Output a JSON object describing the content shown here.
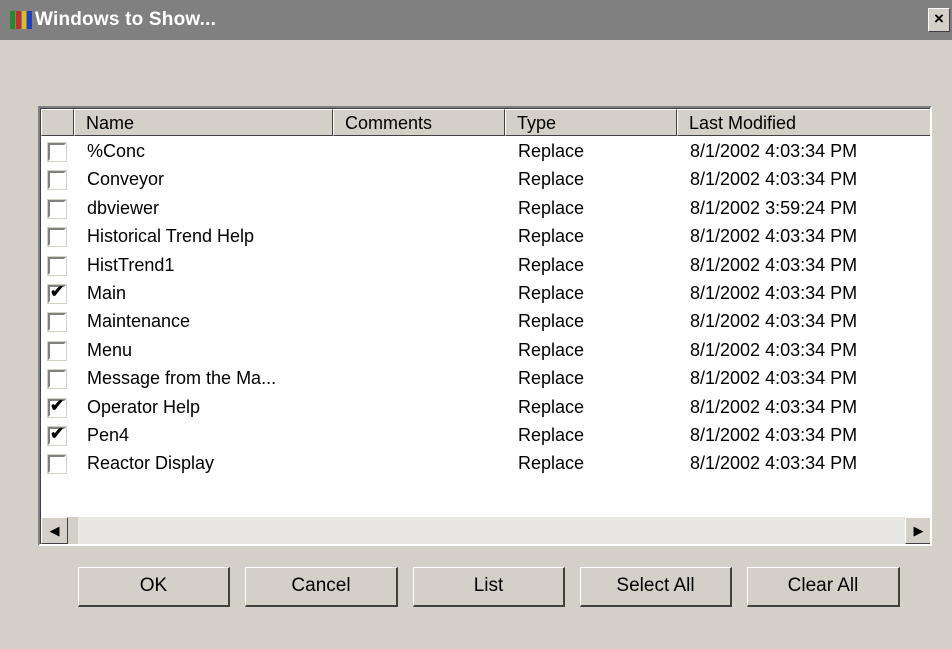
{
  "window": {
    "title": "Windows to Show...",
    "close_label": "×"
  },
  "columns": [
    "Name",
    "Comments",
    "Type",
    "Last Modified"
  ],
  "rows": [
    {
      "checked": false,
      "name": "%Conc",
      "comments": "",
      "type": "Replace",
      "modified": "8/1/2002 4:03:34 PM"
    },
    {
      "checked": false,
      "name": "Conveyor",
      "comments": "",
      "type": "Replace",
      "modified": "8/1/2002 4:03:34 PM"
    },
    {
      "checked": false,
      "name": "dbviewer",
      "comments": "",
      "type": "Replace",
      "modified": "8/1/2002 3:59:24 PM"
    },
    {
      "checked": false,
      "name": "Historical Trend Help",
      "comments": "",
      "type": "Replace",
      "modified": "8/1/2002 4:03:34 PM"
    },
    {
      "checked": false,
      "name": "HistTrend1",
      "comments": "",
      "type": "Replace",
      "modified": "8/1/2002 4:03:34 PM"
    },
    {
      "checked": true,
      "name": "Main",
      "comments": "",
      "type": "Replace",
      "modified": "8/1/2002 4:03:34 PM"
    },
    {
      "checked": false,
      "name": "Maintenance",
      "comments": "",
      "type": "Replace",
      "modified": "8/1/2002 4:03:34 PM"
    },
    {
      "checked": false,
      "name": "Menu",
      "comments": "",
      "type": "Replace",
      "modified": "8/1/2002 4:03:34 PM"
    },
    {
      "checked": false,
      "name": "Message from the Ma...",
      "comments": "",
      "type": "Replace",
      "modified": "8/1/2002 4:03:34 PM"
    },
    {
      "checked": true,
      "name": "Operator Help",
      "comments": "",
      "type": "Replace",
      "modified": "8/1/2002 4:03:34 PM"
    },
    {
      "checked": true,
      "name": "Pen4",
      "comments": "",
      "type": "Replace",
      "modified": "8/1/2002 4:03:34 PM"
    },
    {
      "checked": false,
      "name": "Reactor Display",
      "comments": "",
      "type": "Replace",
      "modified": "8/1/2002 4:03:34 PM"
    }
  ],
  "scrollbar": {
    "left_arrow": "◀",
    "right_arrow": "▶"
  },
  "buttons": {
    "ok": "OK",
    "cancel": "Cancel",
    "list": "List",
    "select_all": "Select All",
    "clear_all": "Clear All"
  },
  "icons": {
    "app": "app-window-icon",
    "close": "close-icon"
  },
  "colors": {
    "titlebar": "#808080",
    "face": "#d4d0c8",
    "list_bg": "#ffffff"
  }
}
